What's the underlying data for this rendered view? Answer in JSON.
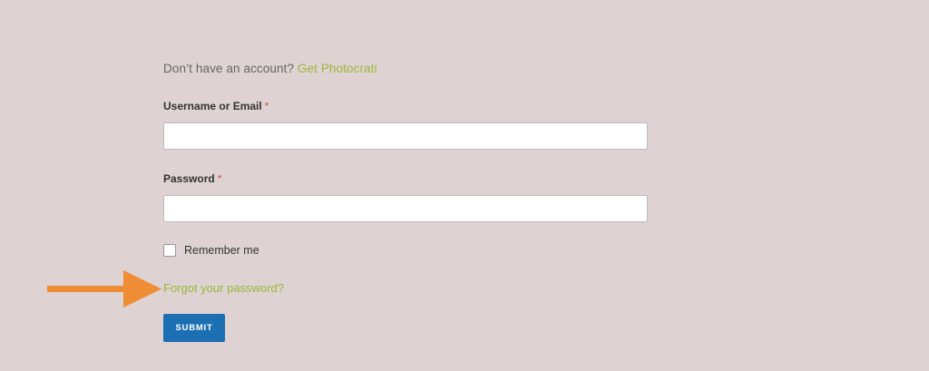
{
  "signup": {
    "prompt": "Don’t have an account?",
    "link_label": "Get Photocrati"
  },
  "form": {
    "username": {
      "label": "Username or Email",
      "required_marker": "*",
      "value": ""
    },
    "password": {
      "label": "Password",
      "required_marker": "*",
      "value": ""
    },
    "remember": {
      "label": "Remember me",
      "checked": false
    },
    "forgot_link": "Forgot your password?",
    "submit_label": "SUBMIT"
  },
  "colors": {
    "background": "#ded2d2",
    "link": "#9bb83a",
    "required": "#d9534f",
    "button": "#1c6fb3",
    "arrow": "#ee8d33"
  },
  "annotation": {
    "icon": "arrow-right-icon"
  }
}
